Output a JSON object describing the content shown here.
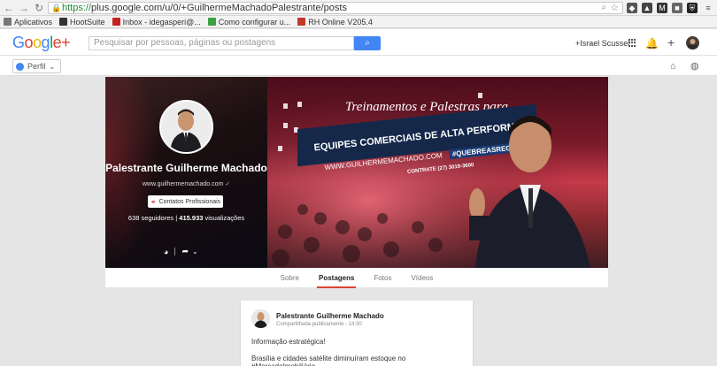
{
  "browser": {
    "url_scheme": "https://",
    "url_rest": "plus.google.com/u/0/+GuilhermeMachadoPalestrante/posts",
    "bookmarks": [
      {
        "label": "Aplicativos",
        "color": "#666666"
      },
      {
        "label": "HootSuite",
        "color": "#333333"
      },
      {
        "label": "Inbox - idegasperi@...",
        "color": "#c5221f"
      },
      {
        "label": "Como configurar u...",
        "color": "#3aa041"
      },
      {
        "label": "RH Online V205.4",
        "color": "#c0392b"
      }
    ]
  },
  "header": {
    "logo": "Google+",
    "search_placeholder": "Pesquisar por pessoas, páginas ou postagens",
    "user_name": "+Israel Scussel"
  },
  "subheader": {
    "perfil_label": "Perfil"
  },
  "profile": {
    "name": "Palestrante Guilherme Machado",
    "site": "www.guilhermemachado.com",
    "contact_button": "Contatos Profissionais",
    "followers": "638 seguidores",
    "views_num": "415.933",
    "views_label": "visualizações"
  },
  "cover": {
    "line1": "Treinamentos e Palestras para",
    "line2": "EQUIPES COMERCIAIS DE ALTA PERFORMANCE",
    "site": "WWW.GUILHERMEMACHADO.COM",
    "hashtag": "#QUEBREASREGRAS",
    "contact": "CONTRATE (27) 3019-3600"
  },
  "tabs": [
    "Sobre",
    "Postagens",
    "Fotos",
    "Vídeos"
  ],
  "active_tab": "Postagens",
  "post": {
    "author": "Palestrante Guilherme Machado",
    "meta": "Compartilhada publicamente  -  14:30",
    "text1": "Informação estratégica!",
    "text2": "Brasília e cidades satélite diminuíram estoque no #MercadoImobiliário."
  },
  "colors": {
    "accent": "#4285f4",
    "tab_indicator": "#db4437",
    "url_green": "#1f8a2e"
  }
}
